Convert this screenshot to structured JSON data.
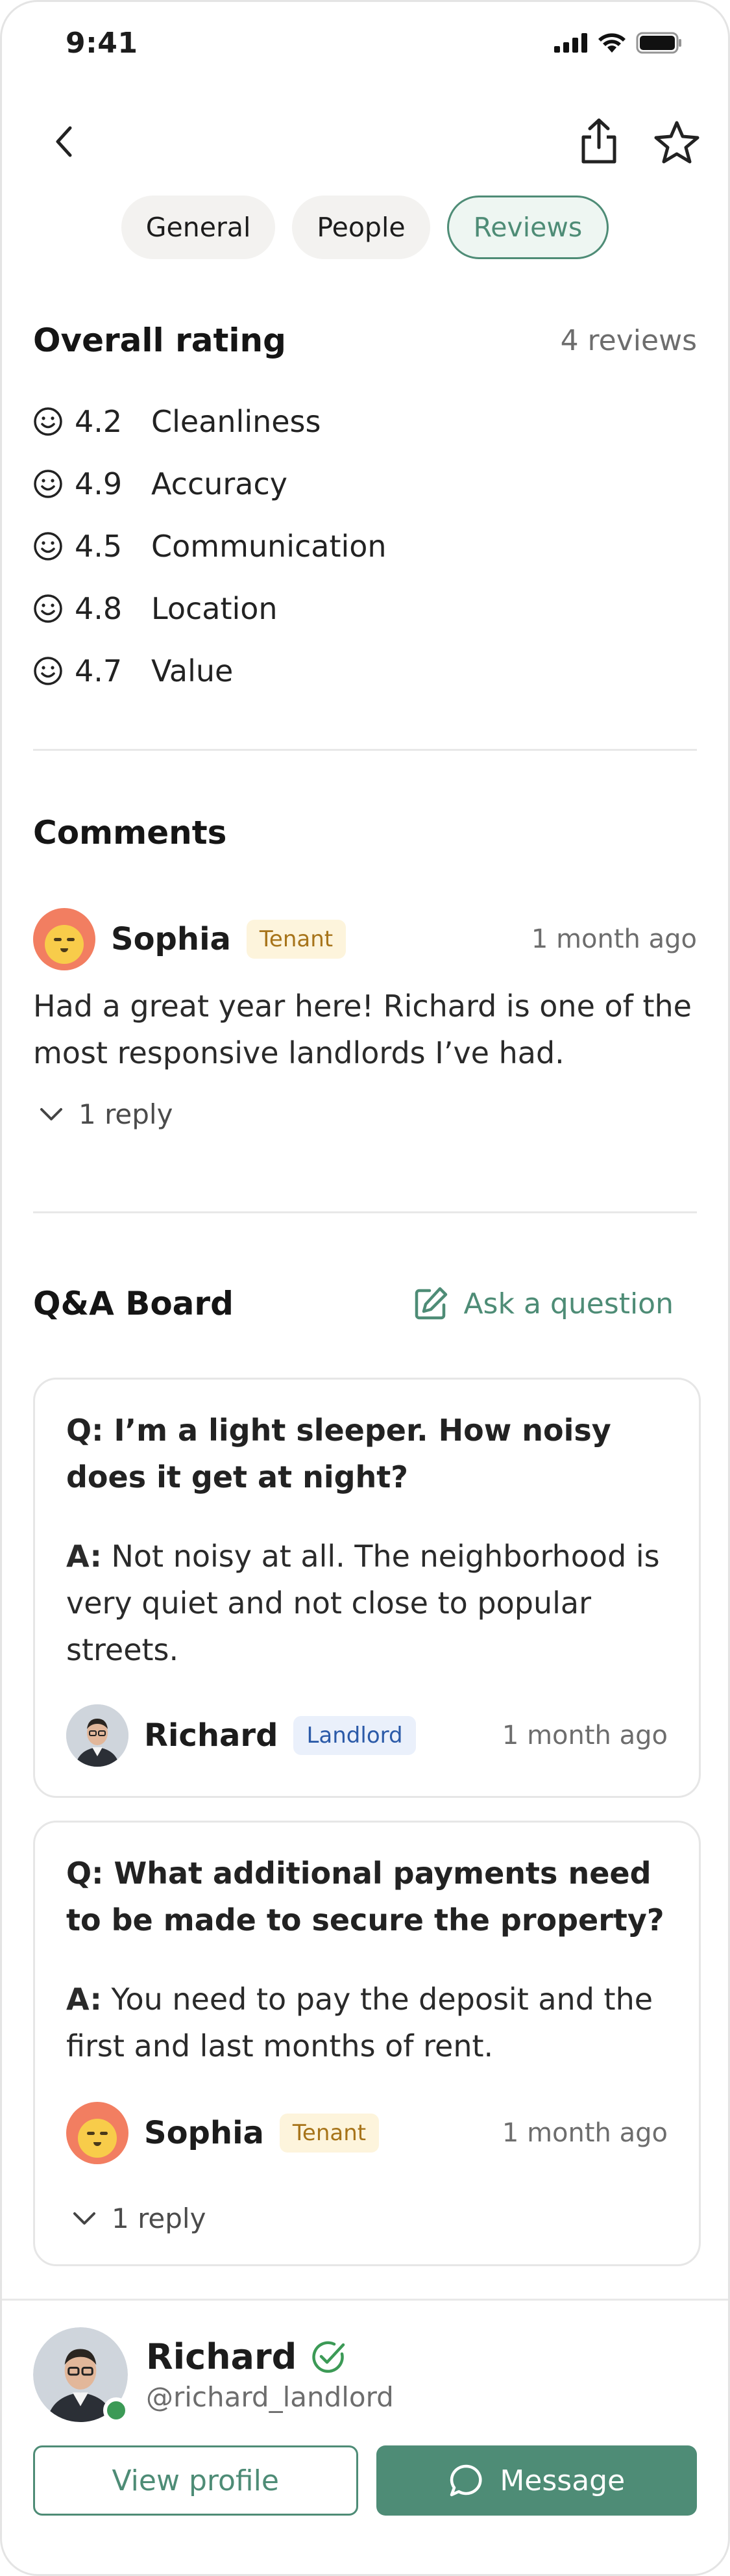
{
  "status_bar": {
    "time": "9:41"
  },
  "tabs": [
    {
      "label": "General"
    },
    {
      "label": "People"
    },
    {
      "label": "Reviews"
    }
  ],
  "overall": {
    "title": "Overall rating",
    "count": "4 reviews",
    "ratings": [
      {
        "score": "4.2",
        "label": "Cleanliness"
      },
      {
        "score": "4.9",
        "label": "Accuracy"
      },
      {
        "score": "4.5",
        "label": "Communication"
      },
      {
        "score": "4.8",
        "label": "Location"
      },
      {
        "score": "4.7",
        "label": "Value"
      }
    ]
  },
  "comments": {
    "title": "Comments",
    "items": [
      {
        "author": "Sophia",
        "role": "Tenant",
        "time": "1 month ago",
        "text": "Had a great year here! Richard is one of the most responsive landlords I’ve had.",
        "replies": "1 reply"
      }
    ]
  },
  "qa": {
    "title": "Q&A Board",
    "ask_label": "Ask a question",
    "items": [
      {
        "question": "Q: I’m a light sleeper. How noisy does it get at night?",
        "answer_prefix": "A:",
        "answer": "Not noisy at all. The neighborhood is very quiet and not close to popular streets.",
        "author": "Richard",
        "role": "Landlord",
        "time": "1 month ago"
      },
      {
        "question": "Q: What additional payments need to be made to secure the property?",
        "answer_prefix": "A:",
        "answer": "You need to pay the deposit and the first and last months of rent.",
        "author": "Sophia",
        "role": "Tenant",
        "time": "1 month ago",
        "replies": "1 reply"
      }
    ]
  },
  "profile": {
    "name": "Richard",
    "handle": "@richard_landlord",
    "view_profile_label": "View profile",
    "message_label": "Message"
  },
  "colors": {
    "accent": "#4e8c76",
    "tenant_badge_bg": "#fdf4dc",
    "landlord_badge_bg": "#eaf0fb",
    "online": "#3c9a56"
  }
}
